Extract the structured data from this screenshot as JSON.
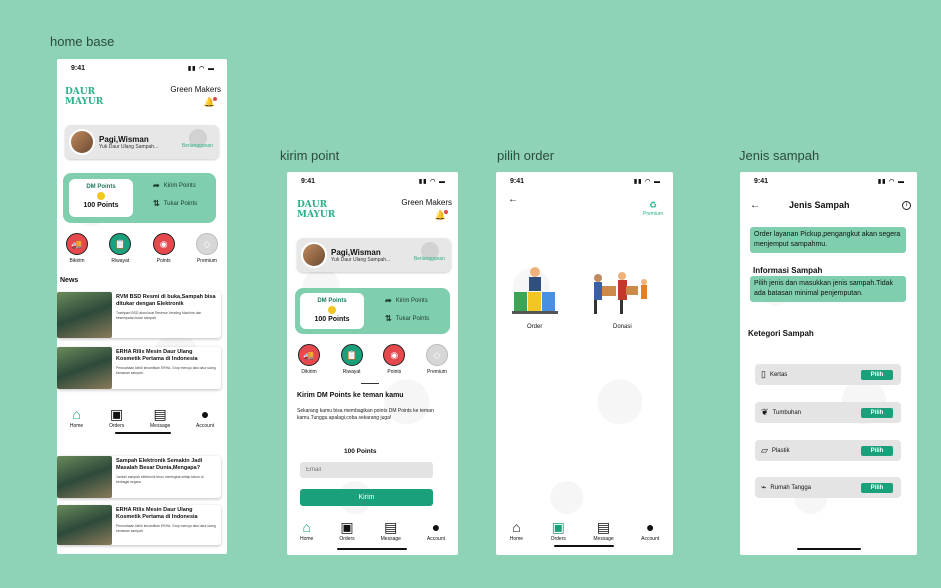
{
  "frames": {
    "home": "home base",
    "kirim": "kirim point",
    "order": "pilih order",
    "jenis": "Jenis sampah"
  },
  "status_time": "9:41",
  "logo": [
    "DAUR",
    "MAYUR"
  ],
  "brand": "Green Makers",
  "greeting": {
    "name": "Pagi,Wisman",
    "sub": "Yuk Daur Ulang Sampah...",
    "badge": "Berlangganan"
  },
  "points": {
    "label": "DM Points",
    "value": "100 Points",
    "send": "Kirim Points",
    "swap": "Tukar Points"
  },
  "menu": [
    {
      "label": "Bikirim",
      "icon": "truck-icon",
      "color": "#e5484d"
    },
    {
      "label": "Riwayat",
      "icon": "clipboard-icon",
      "color": "#1aa07a"
    },
    {
      "label": "Points",
      "icon": "coins-icon",
      "color": "#e5484d"
    },
    {
      "label": "Premium",
      "icon": "diamond-icon",
      "color": "#cfcfcf"
    }
  ],
  "menu_kirim": [
    "Dikirim",
    "Riwayat",
    "Points",
    "Premium"
  ],
  "news": {
    "title": "News",
    "items": [
      {
        "head": "RVM BSD Resmi di buka,Sampah bisa ditukar dengan Elektronik",
        "body": "Trashpart BSD akan buat Reverse Vending Machine dan kesempatan tukar sampah."
      },
      {
        "head": "ERHA Rilis Mesin Daur Ulang Kosmetik Pertama di Indonesia",
        "body": "Perusahaan klinik kecantikan ERHA, Grup menuju aksi daur ulang kemasan sampah."
      },
      {
        "head": "Sampah Elektronik Semakin Jadi Masalah Besar Dunia,Mengapa?",
        "body": "Jumlah sampah elektronik terus meningkat setiap tahun di berbagai negara."
      },
      {
        "head": "ERHA Rilis Mesin Daur Ulang Kosmetik Pertama di Indonesia",
        "body": "Perusahaan klinik kecantikan ERHA, Grup menuju aksi daur ulang kemasan sampah."
      }
    ]
  },
  "nav": [
    "Home",
    "Orders",
    "Message",
    "Account"
  ],
  "kirim_form": {
    "title": "Kirim DM Points ke teman kamu",
    "desc": "Sekarang kamu bisa membagikan points DM Points ke teman kamu.Tunggu apalagi,coba sekarang juga!",
    "points": "100 Points",
    "email_placeholder": "Email",
    "send": "Kirim"
  },
  "order": {
    "premium": "Premium",
    "order": "Order",
    "donasi": "Donasi"
  },
  "jenis": {
    "title": "Jenis Sampah",
    "bubble1": "Order layanan Pickup,pengangkut akan segera menjemput sampahmu.",
    "info_title": "Informasi Sampah",
    "bubble2": "Pilih jenis dan masukkan jenis sampah.Tidak ada batasan minimal penjemputan.",
    "cat_title": "Ketegori Sampah",
    "categories": [
      "Kertas",
      "Tumbuhan",
      "Plastik",
      "Rumah Tangga"
    ],
    "pick": "Pilih"
  }
}
